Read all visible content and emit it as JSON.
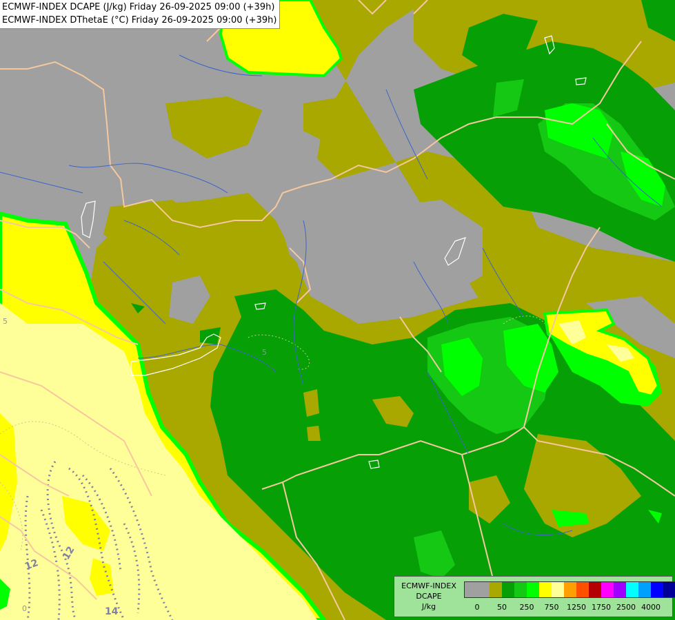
{
  "header": {
    "line1": "ECMWF-INDEX DCAPE (J/kg) Friday 26-09-2025 09:00 (+39h)",
    "line2": "ECMWF-INDEX DThetaE (°C) Friday 26-09-2025 09:00 (+39h)"
  },
  "legend": {
    "title_line1": "ECMWF-INDEX",
    "title_line2": "DCAPE",
    "title_line3": "J/kg",
    "ticks": [
      "0",
      "50",
      "250",
      "750",
      "1250",
      "1750",
      "2500",
      "4000"
    ],
    "colors": [
      "#a0a0a0",
      "#a0a0a0",
      "#a8a800",
      "#06a006",
      "#14c814",
      "#00ff00",
      "#ffff00",
      "#ffff99",
      "#ffa000",
      "#ff5000",
      "#b40000",
      "#ff00ff",
      "#a000ff",
      "#00ffff",
      "#00a0ff",
      "#0000ff",
      "#000096"
    ]
  },
  "contour_labels": [
    "5",
    "5",
    "12",
    "12",
    "14",
    "0"
  ],
  "palette": {
    "gray": "#a0a0a0",
    "olive": "#a8a800",
    "dark_green": "#06a006",
    "green": "#14c814",
    "light_green": "#00ff00",
    "yellow": "#ffff00",
    "pale_yellow": "#ffff99",
    "border": "#f5c8a0",
    "river": "#3c64c8"
  }
}
